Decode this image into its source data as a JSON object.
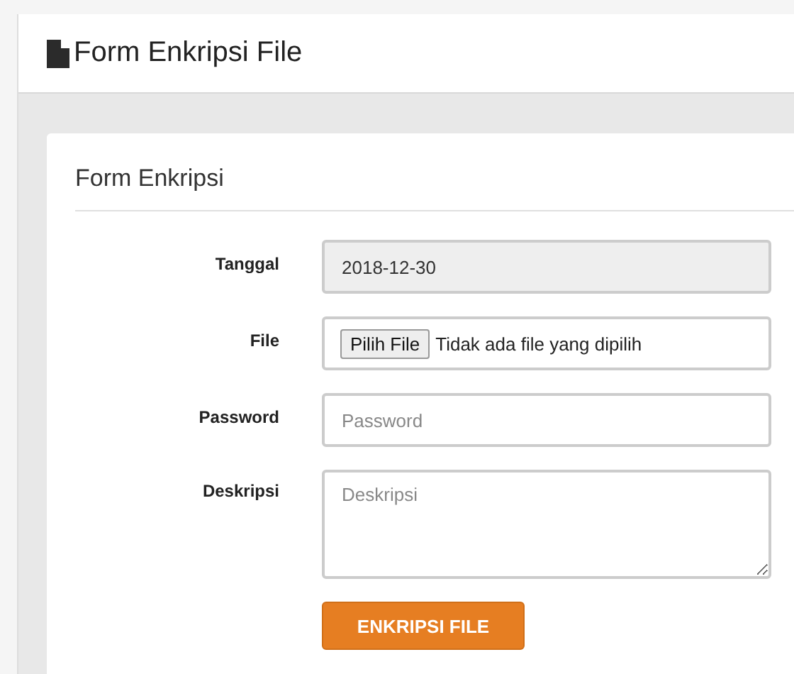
{
  "page_header": {
    "title": "Form Enkripsi File"
  },
  "card": {
    "title": "Form Enkripsi"
  },
  "fields": [
    {
      "kind": "text",
      "label": "Tanggal",
      "value": "2018-12-30",
      "disabled": true
    },
    {
      "kind": "file",
      "label": "File",
      "button": "Pilih File",
      "status": "Tidak ada file yang dipilih",
      "disabled": false
    },
    {
      "kind": "password",
      "label": "Password",
      "placeholder": "Password",
      "disabled": false
    },
    {
      "kind": "textarea",
      "label": "Deskripsi",
      "placeholder": "Deskripsi",
      "disabled": false
    }
  ],
  "submit_button": "ENKRIPSI FILE"
}
